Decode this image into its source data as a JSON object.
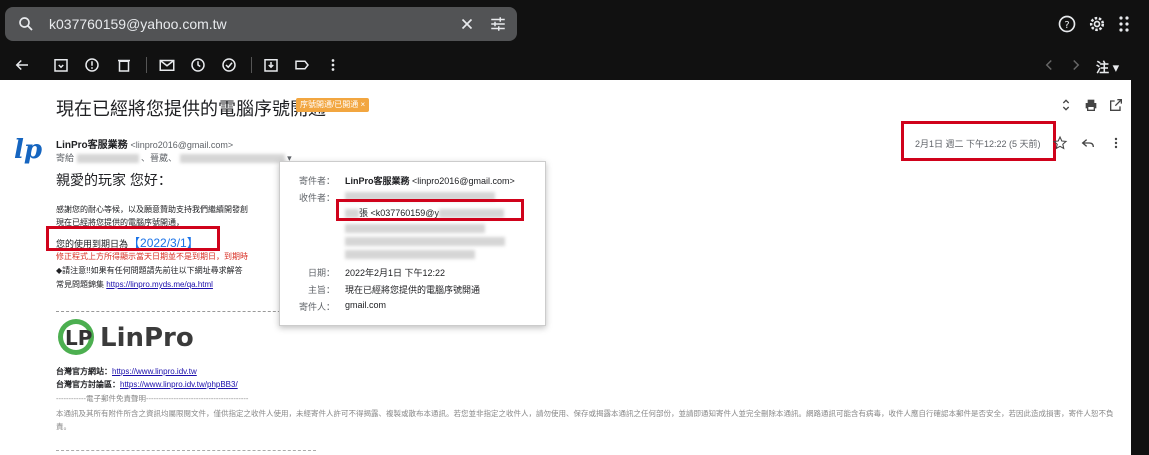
{
  "search": {
    "query": "k037760159@yahoo.com.tw"
  },
  "toolbar": {
    "lang": "注"
  },
  "email": {
    "subject": "現在已經將您提供的電腦序號開通",
    "label": "序號開通/已開通 ×",
    "sender_name": "LinPro客服業務",
    "sender_email": "<linpro2016@gmail.com>",
    "to_prefix": "寄給",
    "to_mid": "、晉葳、",
    "date": "2月1日 週二 下午12:22 (5 天前)",
    "greeting": "親愛的玩家 您好：",
    "line1": "感謝您的耐心等候，以及願意贊助支持我們繼續開發創",
    "line2": "現在已經將您提供的電腦序號開通，",
    "expiry_label": "您的使用到期日為",
    "expiry_date": "【2022/3/1】",
    "line3": "修正程式上方所得顯示當天日期並不是到期日，到期時",
    "line4": "◆請注意!!如果有任何問題請先前往以下網址尋求解答",
    "faq_label": "常見問題錦集",
    "faq_link": "https://linpro.myds.me/qa.html",
    "logo_text": "LinPro",
    "site_label": "台灣官方網站：",
    "site_link": "https://www.linpro.idv.tw",
    "forum_label": "台灣官方討論區：",
    "forum_link": "https://www.linpro.idv.tw/phpBB3/",
    "disclaimer_title": "------------電子郵件免責聲明-----------------------------------------",
    "disclaimer": "本通訊及其所有附件所含之資訊均屬限閱文件，僅供指定之收件人使用，未經寄件人許可不得揭露、複製或散布本通訊。若您並非指定之收件人，請勿使用、保存或揭露本通訊之任何部份，並請即通知寄件人並完全刪除本通訊。網路通訊可能含有病毒，收件人應自行確認本郵件是否安全，若因此造成損害，寄件人恕不負責。"
  },
  "popup": {
    "from_label": "寄件者：",
    "from_name": "LinPro客服業務",
    "from_email": "<linpro2016@gmail.com>",
    "to_label": "收件者：",
    "to_value": "張 <k037760159@y",
    "date_label": "日期：",
    "date_value": "2022年2月1日 下午12:22",
    "subject_label": "主旨：",
    "subject_value": "現在已經將您提供的電腦序號開通",
    "sender_label": "寄件人：",
    "sender_value": "gmail.com"
  }
}
